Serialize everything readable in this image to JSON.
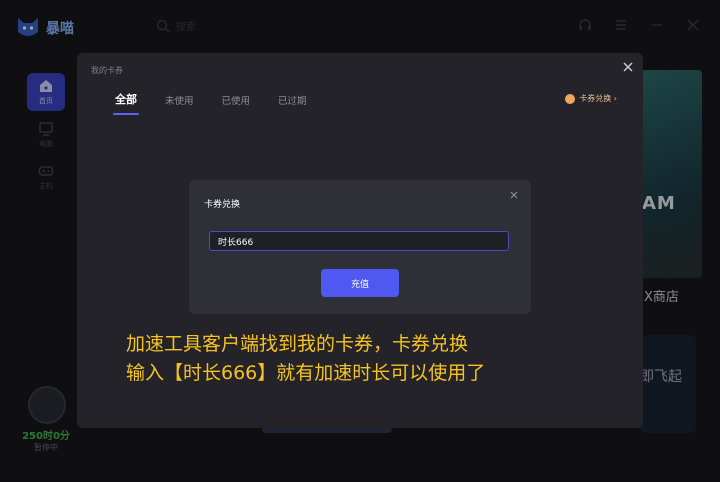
{
  "app": {
    "brand": "暴喵",
    "search_placeholder": "搜索"
  },
  "sidebar": {
    "items": [
      {
        "label": "首页",
        "icon": "home-icon",
        "active": true
      },
      {
        "label": "电脑",
        "icon": "monitor-icon"
      },
      {
        "label": "主机",
        "icon": "console-icon"
      }
    ],
    "remaining_time": "250时0分",
    "status": "暂停中"
  },
  "background": {
    "steam_text": "AM",
    "store_text": "X商店",
    "fly_text": "即飞起"
  },
  "modal": {
    "title": "我的卡券",
    "tabs": [
      {
        "label": "全部",
        "active": true
      },
      {
        "label": "未使用"
      },
      {
        "label": "已使用"
      },
      {
        "label": "已过期"
      }
    ],
    "redeem_link": "卡券兑换 ›"
  },
  "dialog": {
    "title": "卡券兑换",
    "input_value": "时长666",
    "submit_label": "充值"
  },
  "caption": {
    "line1": "加速工具客户端找到我的卡券，卡券兑换",
    "line2": "输入【时长666】就有加速时长可以使用了"
  },
  "colors": {
    "accent": "#4f58f0",
    "caption": "#f7c320",
    "time": "#3fb950",
    "link": "#e8c29a"
  }
}
